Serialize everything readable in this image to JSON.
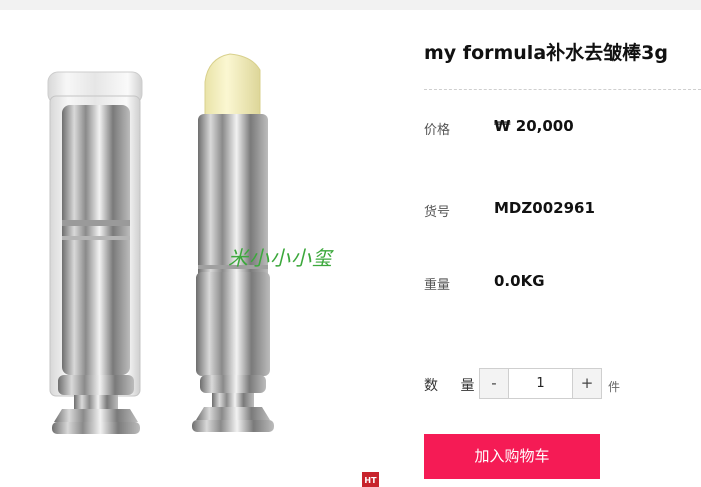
{
  "product": {
    "title": "my formula补水去皱棒3g",
    "watermark_text": "米小小小玺",
    "badge_text": "HT"
  },
  "details": {
    "price_label": "价格",
    "price_value": "₩ 20,000",
    "sku_label": "货号",
    "sku_value": "MDZ002961",
    "weight_label": "重量",
    "weight_value": "0.0KG"
  },
  "quantity": {
    "label": "数 量",
    "minus": "-",
    "value": "1",
    "plus": "+",
    "unit": "件"
  },
  "actions": {
    "add_to_cart": "加入购物车"
  },
  "colors": {
    "accent": "#f51b55",
    "watermark": "#3ca83c",
    "badge": "#c8232c"
  }
}
